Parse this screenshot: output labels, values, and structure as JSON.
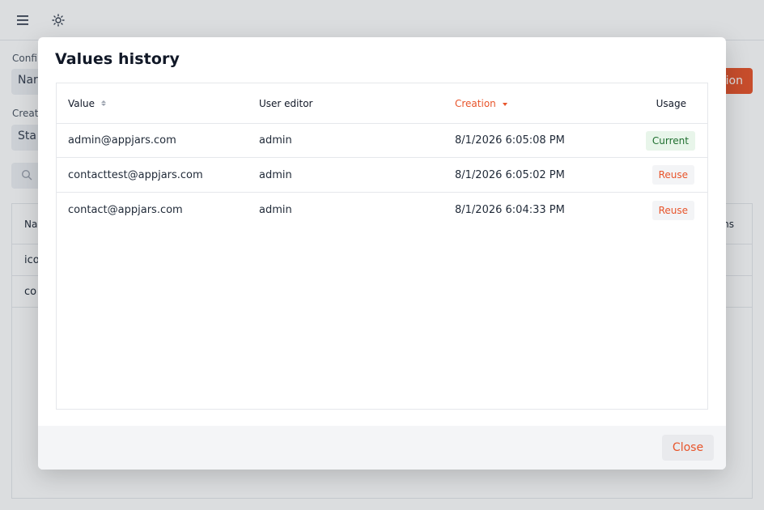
{
  "background": {
    "label_config": "Confi",
    "input_name": "Nar",
    "label_creation": "Creat",
    "input_status": "Sta",
    "accent_button": "tion",
    "table_header_left": "Nar",
    "table_header_right": "ns",
    "table_rows": [
      "ico",
      "co"
    ]
  },
  "modal": {
    "title": "Values history",
    "columns": {
      "value": "Value",
      "user_editor": "User editor",
      "creation": "Creation",
      "usage": "Usage"
    },
    "rows": [
      {
        "value": "admin@appjars.com",
        "user": "admin",
        "creation": "8/1/2026 6:05:08 PM",
        "usage": "Current"
      },
      {
        "value": "contacttest@appjars.com",
        "user": "admin",
        "creation": "8/1/2026 6:05:02 PM",
        "usage": "Reuse"
      },
      {
        "value": "contact@appjars.com",
        "user": "admin",
        "creation": "8/1/2026 6:04:33 PM",
        "usage": "Reuse"
      }
    ],
    "close_label": "Close"
  },
  "colors": {
    "accent": "#e8542a",
    "current_badge_bg": "#e8f5ea",
    "current_badge_text": "#1f6f2f"
  },
  "icons": {
    "menu": "hamburger-menu-icon",
    "theme": "sun-icon",
    "search": "search-icon"
  }
}
